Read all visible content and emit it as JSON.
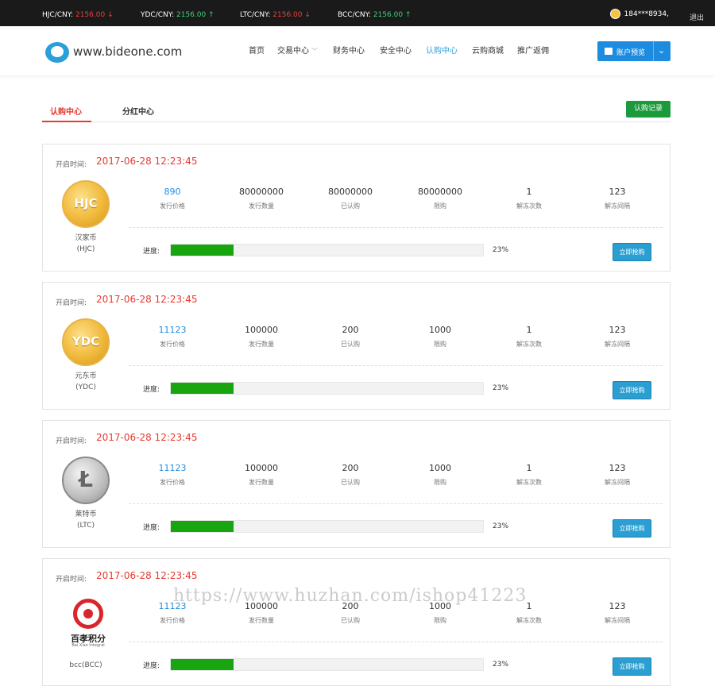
{
  "ticker": [
    {
      "label": "HJC/CNY:",
      "price": "2156.00",
      "arrow": "↓",
      "dir": "down"
    },
    {
      "label": "YDC/CNY:",
      "price": "2156.00",
      "arrow": "↑",
      "dir": "up"
    },
    {
      "label": "LTC/CNY:",
      "price": "2156.00",
      "arrow": "↓",
      "dir": "down"
    },
    {
      "label": "BCC/CNY:",
      "price": "2156.00",
      "arrow": "↑",
      "dir": "up"
    }
  ],
  "user": {
    "phone": "184***8934",
    "separator": ",",
    "logout": "退出"
  },
  "header": {
    "logo": "www.bideone.com",
    "nav": [
      "首页",
      "交易中心",
      "财务中心",
      "安全中心",
      "认购中心",
      "云购商城",
      "推广返佣"
    ],
    "account_button": "账户预览"
  },
  "tabs": {
    "items": [
      "认购中心",
      "分红中心"
    ],
    "record_button": "认购记录"
  },
  "labels": {
    "open_time": "开启时间:",
    "price": "发行价格",
    "quantity": "发行数量",
    "subscribed": "已认购",
    "limit": "限购",
    "unlock_times": "解冻次数",
    "unlock_interval": "解冻间隔",
    "progress": "进度:",
    "buy": "立即抢购"
  },
  "cards": [
    {
      "time": "2017-06-28 12:23:45",
      "coin_text": "HJC",
      "name": "汉家币",
      "symbol": "(HJC)",
      "price": "890",
      "quantity": "80000000",
      "subscribed": "80000000",
      "limit": "80000000",
      "unlock_times": "1",
      "unlock_interval": "123",
      "progress": "23%",
      "progress_value": 0.2
    },
    {
      "time": "2017-06-28 12:23:45",
      "coin_text": "YDC",
      "name": "元东币",
      "symbol": "(YDC)",
      "price": "11123",
      "quantity": "100000",
      "subscribed": "200",
      "limit": "1000",
      "unlock_times": "1",
      "unlock_interval": "123",
      "progress": "23%",
      "progress_value": 0.2
    },
    {
      "time": "2017-06-28 12:23:45",
      "coin_text": "Ł",
      "name": "莱特币",
      "symbol": "(LTC)",
      "price": "11123",
      "quantity": "100000",
      "subscribed": "200",
      "limit": "1000",
      "unlock_times": "1",
      "unlock_interval": "123",
      "progress": "23%",
      "progress_value": 0.2
    },
    {
      "time": "2017-06-28 12:23:45",
      "coin_text": "百孝积分",
      "coin_text_en": "Bai Xiao Integral",
      "name": "bcc(BCC)",
      "symbol": "",
      "price": "11123",
      "quantity": "100000",
      "subscribed": "200",
      "limit": "1000",
      "unlock_times": "1",
      "unlock_interval": "123",
      "progress": "23%",
      "progress_value": 0.2
    }
  ],
  "watermark": "https://www.huzhan.com/ishop41223"
}
